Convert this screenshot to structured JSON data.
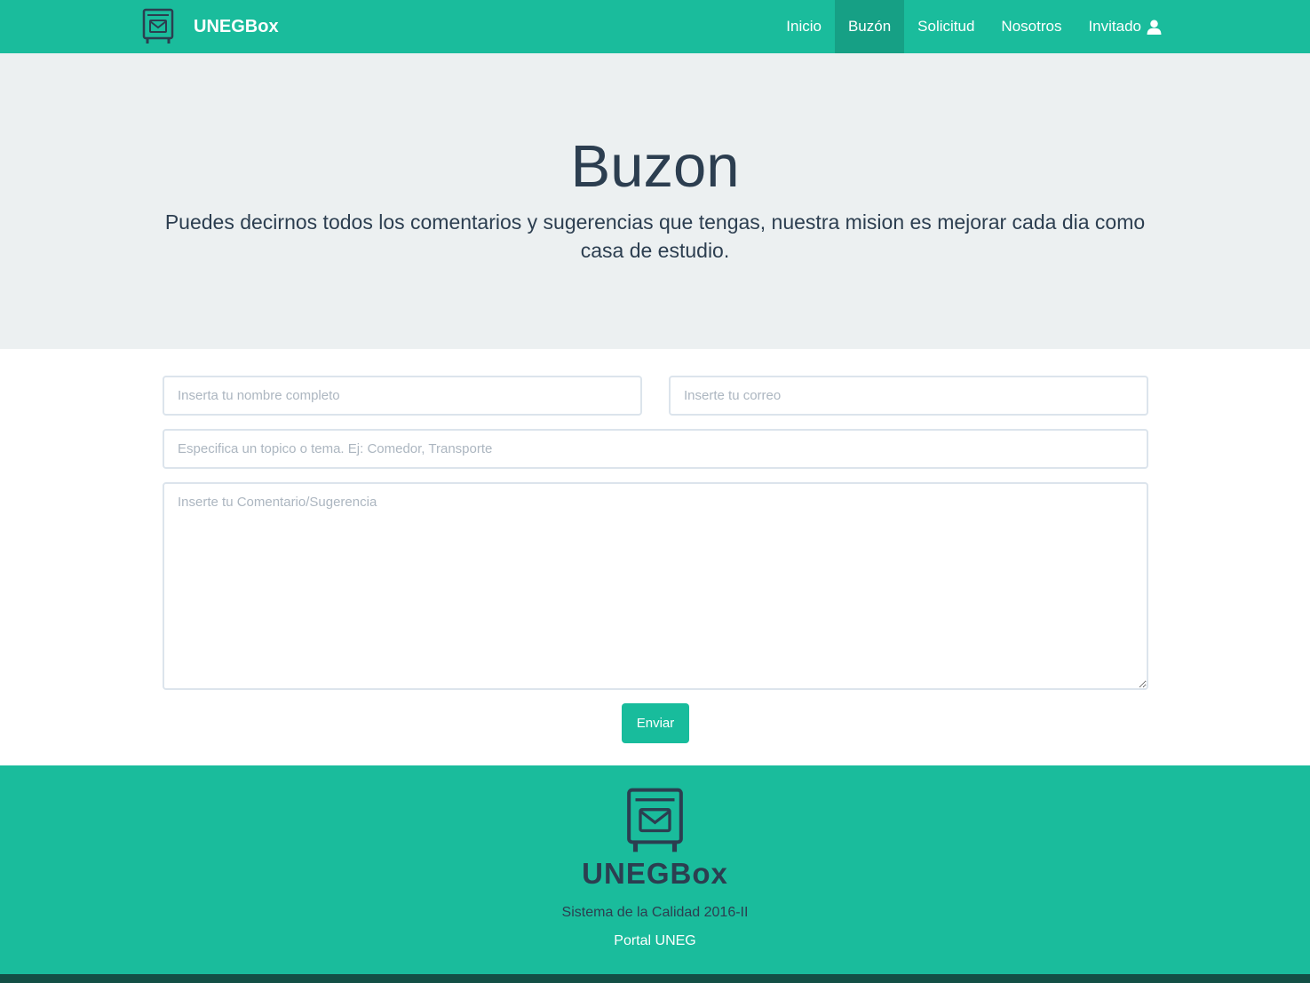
{
  "navbar": {
    "brand": "UNEGBox",
    "brand_icon": "mailbox-icon",
    "links": [
      {
        "label": "Inicio",
        "active": false
      },
      {
        "label": "Buzón",
        "active": true
      },
      {
        "label": "Solicitud",
        "active": false
      },
      {
        "label": "Nosotros",
        "active": false
      },
      {
        "label": "Invitado",
        "active": false,
        "icon": "user-icon"
      }
    ]
  },
  "jumbotron": {
    "title": "Buzon",
    "subtitle": "Puedes decirnos todos los comentarios y sugerencias que tengas, nuestra mision es mejorar cada dia como casa de estudio."
  },
  "form": {
    "name_placeholder": "Inserta tu nombre completo",
    "name_value": "",
    "email_placeholder": "Inserte tu correo",
    "email_value": "",
    "topic_placeholder": "Especifica un topico o tema. Ej: Comedor, Transporte",
    "topic_value": "",
    "comment_placeholder": "Inserte tu Comentario/Sugerencia",
    "comment_value": "",
    "submit_label": "Enviar"
  },
  "footer": {
    "brand": "UNEGBox",
    "brand_icon": "mailbox-icon",
    "tagline": "Sistema de la Calidad 2016-II",
    "link_label": "Portal UNEG"
  },
  "colors": {
    "primary": "#1abc9c",
    "primary_dark": "#16a085",
    "text_dark": "#2c3e50",
    "jumbotron_bg": "#ecf0f1",
    "footer_bottom": "#134f45"
  }
}
